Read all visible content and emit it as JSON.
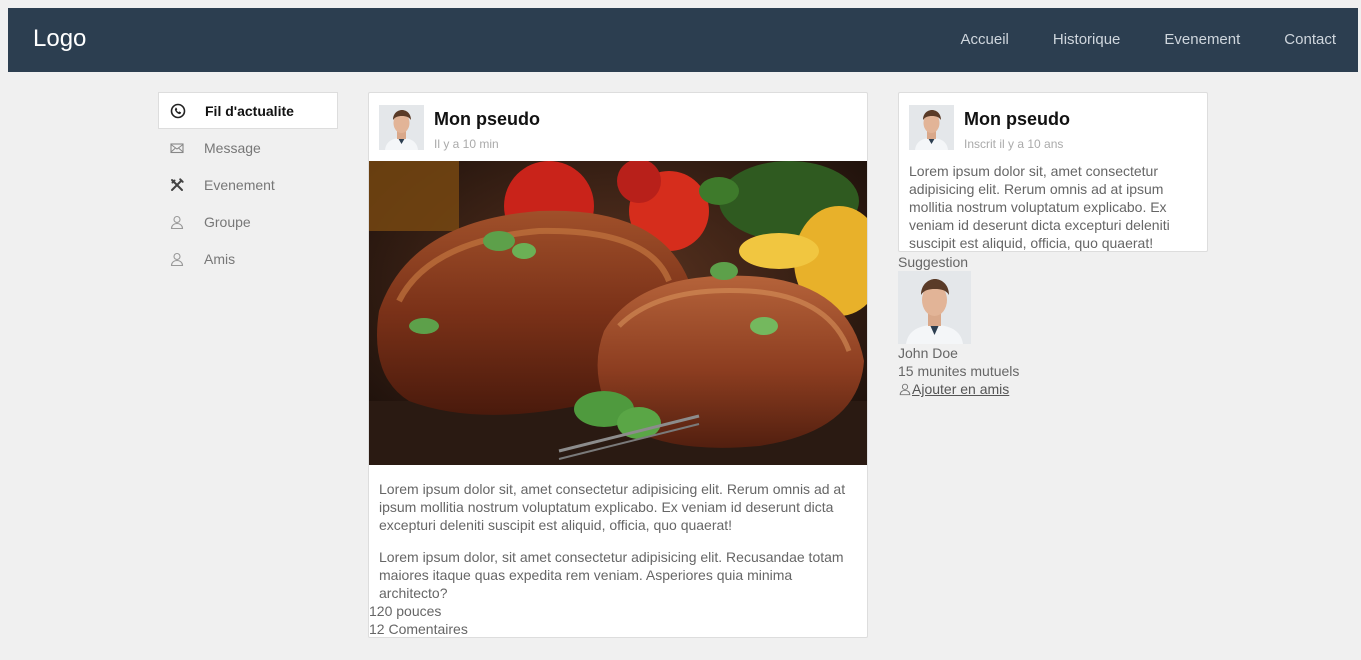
{
  "navbar": {
    "logo": "Logo",
    "links": [
      "Accueil",
      "Historique",
      "Evenement",
      "Contact"
    ]
  },
  "sidebar": {
    "items": [
      {
        "label": "Fil d'actualite",
        "icon": "phone-icon",
        "active": true
      },
      {
        "label": "Message",
        "icon": "envelope-icon",
        "active": false
      },
      {
        "label": "Evenement",
        "icon": "tools-icon",
        "active": false
      },
      {
        "label": "Groupe",
        "icon": "user-icon",
        "active": false
      },
      {
        "label": "Amis",
        "icon": "user-icon",
        "active": false
      }
    ]
  },
  "post": {
    "author": "Mon pseudo",
    "time": "Il y a 10 min",
    "paragraphs": [
      "Lorem ipsum dolor sit, amet consectetur adipisicing elit. Rerum omnis ad at ipsum mollitia nostrum voluptatum explicabo. Ex veniam id deserunt dicta excepturi deleniti suscipit est aliquid, officia, quo quaerat!",
      "Lorem ipsum dolor, sit amet consectetur adipisicing elit. Recusandae totam maiores itaque quas expedita rem veniam. Asperiores quia minima architecto?"
    ],
    "likes": "120 pouces",
    "comments": "12 Comentaires"
  },
  "profile": {
    "name": "Mon pseudo",
    "since": "Inscrit il y a 10 ans",
    "bio": "Lorem ipsum dolor sit, amet consectetur adipisicing elit. Rerum omnis ad at ipsum mollitia nostrum voluptatum explicabo. Ex veniam id deserunt dicta excepturi deleniti suscipit est aliquid, officia, quo quaerat!"
  },
  "suggestion": {
    "heading": "Suggestion",
    "name": "John Doe",
    "mutual": "15 munites mutuels",
    "add_label": "Ajouter en amis"
  },
  "colors": {
    "navbar": "#2c3e50",
    "background": "#f0f0f0"
  }
}
